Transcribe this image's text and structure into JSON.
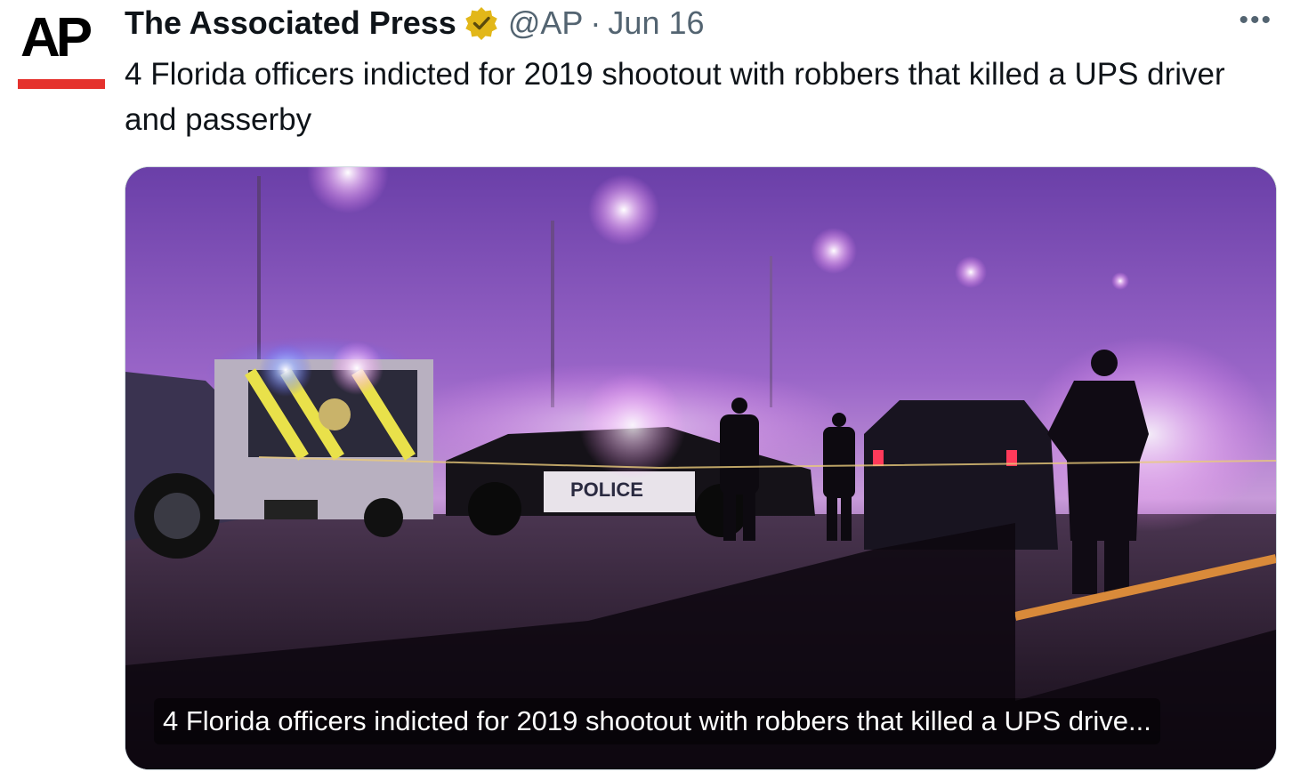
{
  "author": {
    "display_name": "The Associated Press",
    "handle": "@AP",
    "separator": "·",
    "date": "Jun 16",
    "avatar_text": "AP",
    "verified_color": "#e2b719"
  },
  "tweet": {
    "text": "4 Florida officers indicted for 2019 shootout with robbers that killed a UPS driver and passerby"
  },
  "card": {
    "caption": "4 Florida officers indicted for 2019 shootout with robbers that killed a UPS drive..."
  },
  "menu": {
    "more_label": "•••"
  },
  "colors": {
    "text": "#0f1419",
    "secondary": "#536471",
    "ap_red": "#e5322d"
  }
}
